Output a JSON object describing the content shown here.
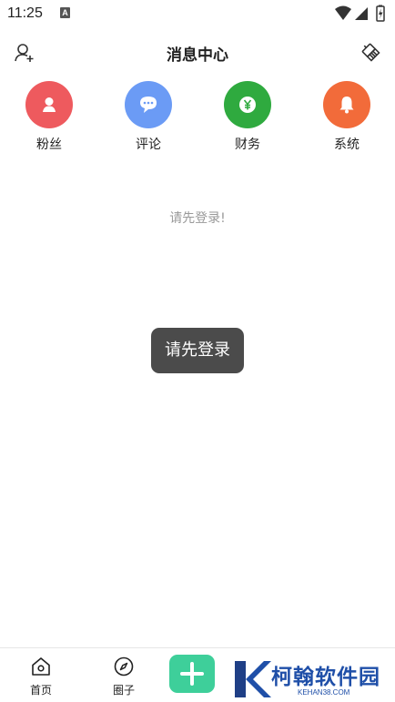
{
  "status_bar": {
    "time": "11:25",
    "indicator": "A"
  },
  "header": {
    "title": "消息中心",
    "left_icon": "add-user-icon",
    "right_icon": "clear-brush-icon"
  },
  "categories": [
    {
      "label": "粉丝",
      "icon": "user-icon",
      "color": "#ee5a5e"
    },
    {
      "label": "评论",
      "icon": "chat-bubble-icon",
      "color": "#6b9bf5"
    },
    {
      "label": "财务",
      "icon": "yen-coin-icon",
      "color": "#2faa3f"
    },
    {
      "label": "系统",
      "icon": "bell-icon",
      "color": "#f26b3a"
    }
  ],
  "empty_hint": "请先登录!",
  "toast": "请先登录",
  "bottom_nav": [
    {
      "label": "首页",
      "icon": "home-icon"
    },
    {
      "label": "圈子",
      "icon": "compass-icon"
    }
  ],
  "plus_button": {
    "icon": "plus-icon",
    "color": "#3ecf9a"
  },
  "watermark": {
    "text": "柯翰软件园",
    "sub": "KEHAN38.COM"
  }
}
